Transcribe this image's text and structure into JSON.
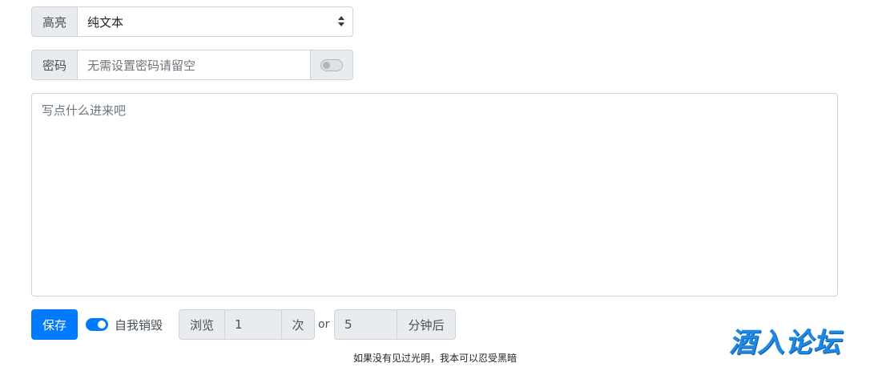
{
  "highlight": {
    "label": "高亮",
    "selected": "纯文本"
  },
  "password": {
    "label": "密码",
    "placeholder": "无需设置密码请留空",
    "toggle_on": false
  },
  "content": {
    "placeholder": "写点什么进来吧"
  },
  "actions": {
    "save_label": "保存",
    "self_destroy_label": "自我销毁",
    "self_destroy_on": true
  },
  "limits": {
    "views_label": "浏览",
    "views_value": "1",
    "views_unit": "次",
    "or_text": "or",
    "minutes_value": "5",
    "minutes_unit": "分钟后"
  },
  "footer": {
    "quote": "如果没有见过光明，我本可以忍受黑暗"
  },
  "watermark": {
    "text": "酒入论坛",
    "color": "#1e88e5"
  },
  "colors": {
    "primary": "#007bff",
    "addon_bg": "#e9ecef",
    "border": "#ced4da"
  }
}
